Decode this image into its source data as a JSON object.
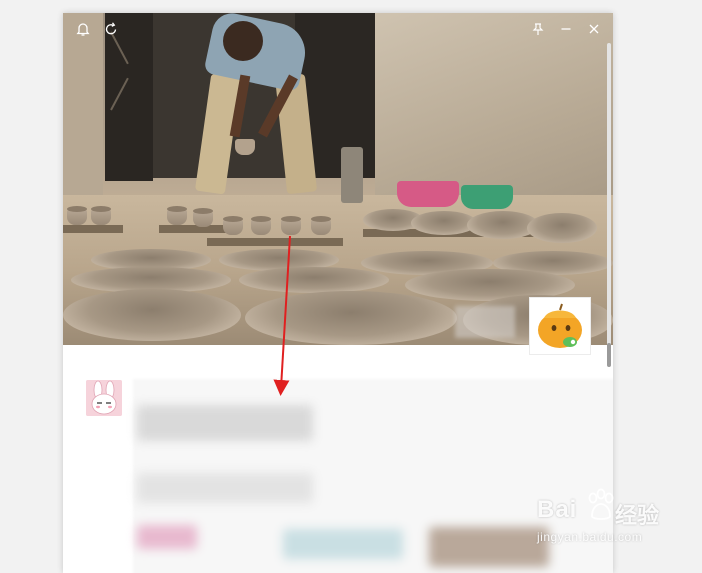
{
  "window": {
    "icons": {
      "notification": "bell-icon",
      "refresh": "refresh-icon",
      "pin": "pin-icon",
      "minimize": "minimize-icon",
      "close": "close-icon"
    }
  },
  "cover": {
    "description_icon": "cover-photo"
  },
  "comment": {
    "avatar_icon": "rabbit-avatar"
  },
  "watermark": {
    "brand": "Bai",
    "brand_suffix": "经验",
    "url": "jingyan.baidu.com"
  },
  "colors": {
    "annotation_arrow": "#e02020",
    "window_bg": "#ffffff",
    "page_bg": "#f2f2f2"
  }
}
